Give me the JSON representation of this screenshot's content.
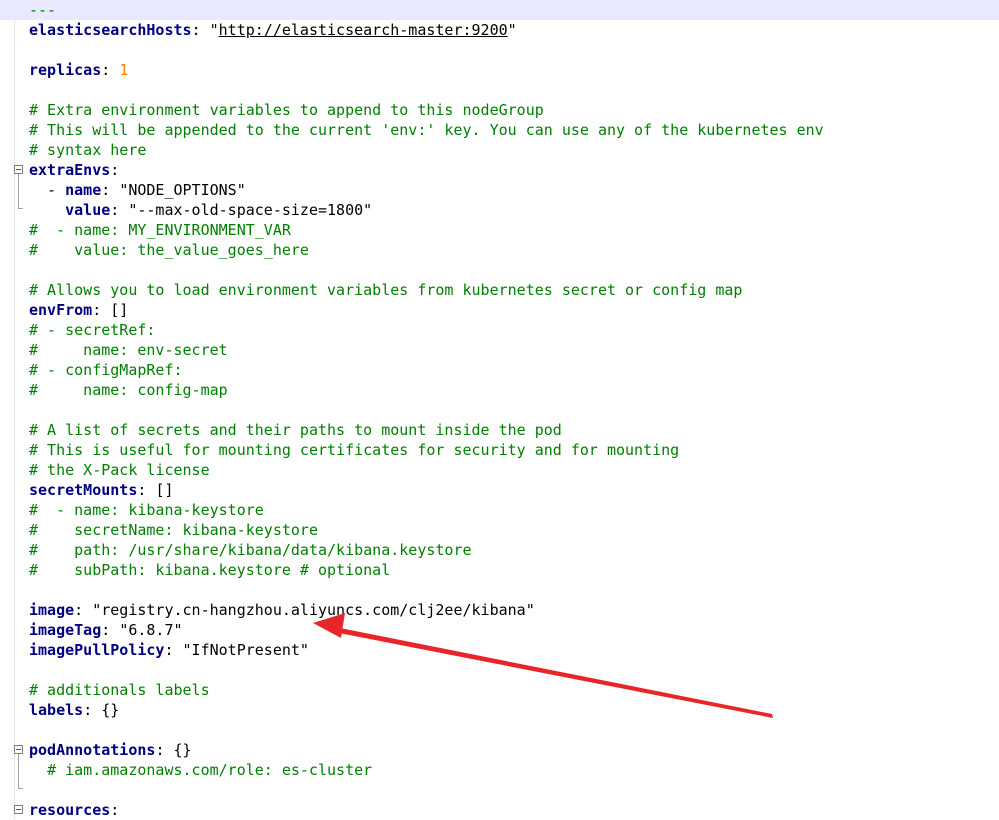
{
  "lines": [
    {
      "indent": "",
      "key": "",
      "sep": "",
      "value": "",
      "comment": "---",
      "doc_marker": true
    },
    {
      "indent": "",
      "key": "elasticsearchHosts",
      "sep": ": ",
      "value": "\"http://elasticsearch-master:9200\"",
      "comment": "",
      "link": true
    },
    {
      "indent": "",
      "key": "",
      "sep": "",
      "value": "",
      "comment": ""
    },
    {
      "indent": "",
      "key": "replicas",
      "sep": ": ",
      "value": "1",
      "comment": "",
      "number": true
    },
    {
      "indent": "",
      "key": "",
      "sep": "",
      "value": "",
      "comment": ""
    },
    {
      "indent": "",
      "key": "",
      "sep": "",
      "value": "",
      "comment": "# Extra environment variables to append to this nodeGroup"
    },
    {
      "indent": "",
      "key": "",
      "sep": "",
      "value": "",
      "comment": "# This will be appended to the current 'env:' key. You can use any of the kubernetes env"
    },
    {
      "indent": "",
      "key": "",
      "sep": "",
      "value": "",
      "comment": "# syntax here"
    },
    {
      "indent": "",
      "key": "extraEnvs",
      "sep": ":",
      "value": "",
      "comment": ""
    },
    {
      "indent": "  - ",
      "key": "name",
      "sep": ": ",
      "value": "\"NODE_OPTIONS\"",
      "comment": ""
    },
    {
      "indent": "    ",
      "key": "value",
      "sep": ": ",
      "value": "\"--max-old-space-size=1800\"",
      "comment": ""
    },
    {
      "indent": "",
      "key": "",
      "sep": "",
      "value": "",
      "comment": "#  - name: MY_ENVIRONMENT_VAR"
    },
    {
      "indent": "",
      "key": "",
      "sep": "",
      "value": "",
      "comment": "#    value: the_value_goes_here"
    },
    {
      "indent": "",
      "key": "",
      "sep": "",
      "value": "",
      "comment": ""
    },
    {
      "indent": "",
      "key": "",
      "sep": "",
      "value": "",
      "comment": "# Allows you to load environment variables from kubernetes secret or config map"
    },
    {
      "indent": "",
      "key": "envFrom",
      "sep": ": ",
      "value": "[]",
      "comment": ""
    },
    {
      "indent": "",
      "key": "",
      "sep": "",
      "value": "",
      "comment": "# - secretRef:"
    },
    {
      "indent": "",
      "key": "",
      "sep": "",
      "value": "",
      "comment": "#     name: env-secret"
    },
    {
      "indent": "",
      "key": "",
      "sep": "",
      "value": "",
      "comment": "# - configMapRef:"
    },
    {
      "indent": "",
      "key": "",
      "sep": "",
      "value": "",
      "comment": "#     name: config-map"
    },
    {
      "indent": "",
      "key": "",
      "sep": "",
      "value": "",
      "comment": ""
    },
    {
      "indent": "",
      "key": "",
      "sep": "",
      "value": "",
      "comment": "# A list of secrets and their paths to mount inside the pod"
    },
    {
      "indent": "",
      "key": "",
      "sep": "",
      "value": "",
      "comment": "# This is useful for mounting certificates for security and for mounting"
    },
    {
      "indent": "",
      "key": "",
      "sep": "",
      "value": "",
      "comment": "# the X-Pack license"
    },
    {
      "indent": "",
      "key": "secretMounts",
      "sep": ": ",
      "value": "[]",
      "comment": ""
    },
    {
      "indent": "",
      "key": "",
      "sep": "",
      "value": "",
      "comment": "#  - name: kibana-keystore"
    },
    {
      "indent": "",
      "key": "",
      "sep": "",
      "value": "",
      "comment": "#    secretName: kibana-keystore"
    },
    {
      "indent": "",
      "key": "",
      "sep": "",
      "value": "",
      "comment": "#    path: /usr/share/kibana/data/kibana.keystore"
    },
    {
      "indent": "",
      "key": "",
      "sep": "",
      "value": "",
      "comment": "#    subPath: kibana.keystore # optional"
    },
    {
      "indent": "",
      "key": "",
      "sep": "",
      "value": "",
      "comment": ""
    },
    {
      "indent": "",
      "key": "image",
      "sep": ": ",
      "value": "\"registry.cn-hangzhou.aliyuncs.com/clj2ee/kibana\"",
      "comment": ""
    },
    {
      "indent": "",
      "key": "imageTag",
      "sep": ": ",
      "value": "\"6.8.7\"",
      "comment": ""
    },
    {
      "indent": "",
      "key": "imagePullPolicy",
      "sep": ": ",
      "value": "\"IfNotPresent\"",
      "comment": ""
    },
    {
      "indent": "",
      "key": "",
      "sep": "",
      "value": "",
      "comment": ""
    },
    {
      "indent": "",
      "key": "",
      "sep": "",
      "value": "",
      "comment": "# additionals labels"
    },
    {
      "indent": "",
      "key": "labels",
      "sep": ": ",
      "value": "{}",
      "comment": ""
    },
    {
      "indent": "",
      "key": "",
      "sep": "",
      "value": "",
      "comment": ""
    },
    {
      "indent": "",
      "key": "podAnnotations",
      "sep": ": ",
      "value": "{}",
      "comment": ""
    },
    {
      "indent": "  ",
      "key": "",
      "sep": "",
      "value": "",
      "comment": "# iam.amazonaws.com/role: es-cluster"
    },
    {
      "indent": "",
      "key": "",
      "sep": "",
      "value": "",
      "comment": ""
    },
    {
      "indent": "",
      "key": "resources",
      "sep": ":",
      "value": "",
      "comment": ""
    }
  ],
  "colors": {
    "key": "#000080",
    "comment": "#008000",
    "number": "#ff8000",
    "string": "#000000",
    "arrow": "#e8262a",
    "current_line": "#e8e8ff"
  },
  "annotation": {
    "shape": "arrow",
    "points_to": "imageTag"
  }
}
